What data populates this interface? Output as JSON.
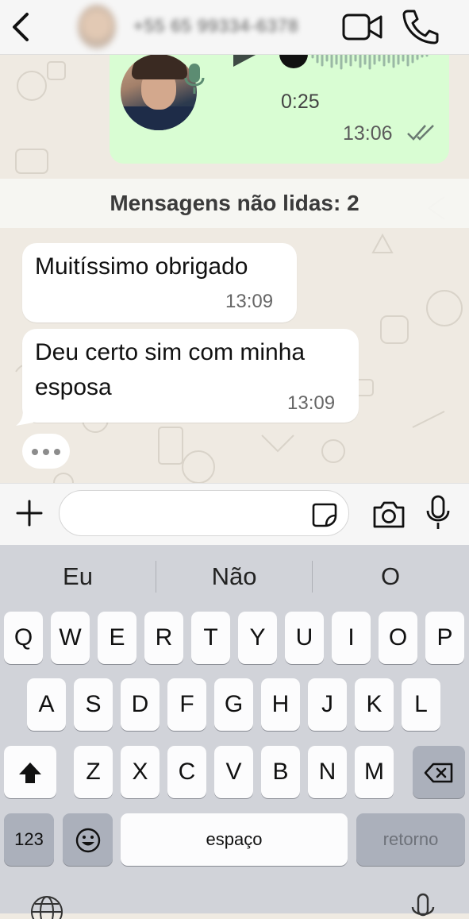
{
  "header": {
    "contact_name": "+55 65 99334-6378"
  },
  "voice_message": {
    "duration": "0:25",
    "time": "13:06"
  },
  "unread_banner": "Mensagens não lidas: 2",
  "messages": [
    {
      "lines": [
        "Muitíssimo obrigado"
      ],
      "time": "13:09"
    },
    {
      "lines": [
        "Deu certo sim com minha",
        "esposa"
      ],
      "time": "13:09"
    }
  ],
  "input": {
    "value": "",
    "placeholder": ""
  },
  "keyboard": {
    "suggestions": [
      "Eu",
      "Não",
      "O"
    ],
    "row1": [
      "Q",
      "W",
      "E",
      "R",
      "T",
      "Y",
      "U",
      "I",
      "O",
      "P"
    ],
    "row2": [
      "A",
      "S",
      "D",
      "F",
      "G",
      "H",
      "J",
      "K",
      "L"
    ],
    "row3": [
      "Z",
      "X",
      "C",
      "V",
      "B",
      "N",
      "M"
    ],
    "numbers_key": "123",
    "space_key": "espaço",
    "return_key": "retorno"
  },
  "colors": {
    "outgoing_bubble": "#d9fdd3",
    "incoming_bubble": "#ffffff",
    "chat_background": "#efeae2",
    "keyboard_background": "#d1d3d9"
  }
}
